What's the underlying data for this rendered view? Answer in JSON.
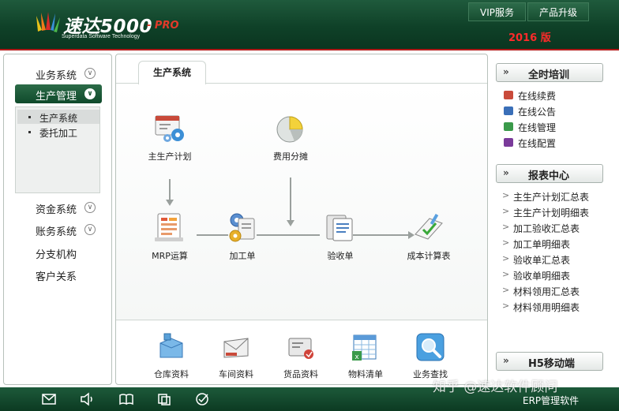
{
  "header": {
    "brand": "速达5000",
    "brand_pro": "- PRO",
    "brand_sub": "Superdata Software Technology",
    "vip_button": "VIP服务",
    "upgrade_button": "产品升级",
    "year": "2016 版",
    "colors": {
      "header_green": "#0f4128",
      "accent_red": "#b21a1a"
    }
  },
  "sidebar": {
    "items": [
      {
        "label": "业务系统",
        "icon": "chevron-circle-down-icon"
      },
      {
        "label": "生产管理",
        "icon": "chevron-circle-down-icon",
        "active": true
      },
      {
        "label": "资金系统",
        "icon": "chevron-circle-down-icon"
      },
      {
        "label": "账务系统",
        "icon": "chevron-circle-down-icon"
      },
      {
        "label": "分支机构"
      },
      {
        "label": "客户关系"
      }
    ],
    "subitems": [
      {
        "label": "生产系统",
        "selected": true
      },
      {
        "label": "委托加工"
      }
    ]
  },
  "main": {
    "tab": "生产系统",
    "flow": {
      "master_plan": "主生产计划",
      "cost_alloc": "费用分摊",
      "mrp": "MRP运算",
      "processing": "加工单",
      "acceptance": "验收单",
      "cost_report": "成本计算表"
    },
    "quick": [
      {
        "label": "仓库资料",
        "icon": "warehouse-box-icon"
      },
      {
        "label": "车间资料",
        "icon": "envelope-icon"
      },
      {
        "label": "货品资料",
        "icon": "goods-card-icon"
      },
      {
        "label": "物料清单",
        "icon": "spreadsheet-icon"
      },
      {
        "label": "业务查找",
        "icon": "magnifier-icon"
      }
    ]
  },
  "right": {
    "training": {
      "title": "全时培训",
      "items": [
        "在线续费",
        "在线公告",
        "在线管理",
        "在线配置"
      ]
    },
    "reports": {
      "title": "报表中心",
      "items": [
        "主生产计划汇总表",
        "主生产计划明细表",
        "加工验收汇总表",
        "加工单明细表",
        "验收单汇总表",
        "验收单明细表",
        "材料领用汇总表",
        "材料领用明细表"
      ]
    },
    "mobile": {
      "title": "H5移动端"
    }
  },
  "footer": {
    "icons": [
      "mail-icon",
      "speaker-icon",
      "book-icon",
      "copy-icon",
      "check-circle-icon"
    ],
    "text": "ERP管理软件",
    "watermark": "知乎 @速达软件顾问"
  }
}
